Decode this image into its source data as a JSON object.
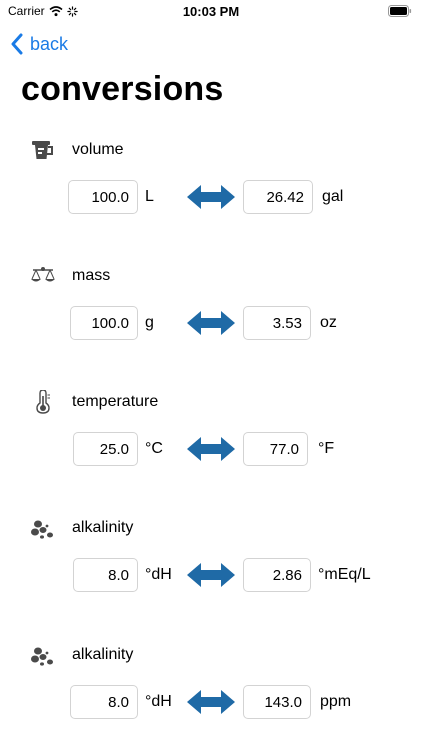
{
  "status_bar": {
    "carrier": "Carrier",
    "time": "10:03 PM"
  },
  "nav": {
    "back_label": "back"
  },
  "page": {
    "title": "conversions"
  },
  "colors": {
    "accent": "#1a7be6",
    "arrow": "#1f6aa6",
    "field_border": "#d3d3d3",
    "icon": "#4a4a4a"
  },
  "sections": [
    {
      "label": "volume",
      "icon": "measuring-cup-icon",
      "left_value": "100.0",
      "left_unit": "L",
      "right_value": "26.42",
      "right_unit": "gal"
    },
    {
      "label": "mass",
      "icon": "balance-scale-icon",
      "left_value": "100.0",
      "left_unit": "g",
      "right_value": "3.53",
      "right_unit": "oz"
    },
    {
      "label": "temperature",
      "icon": "thermometer-icon",
      "left_value": "25.0",
      "left_unit": "°C",
      "right_value": "77.0",
      "right_unit": "°F"
    },
    {
      "label": "alkalinity",
      "icon": "particles-icon",
      "left_value": "8.0",
      "left_unit": "°dH",
      "right_value": "2.86",
      "right_unit": "°mEq/L"
    },
    {
      "label": "alkalinity",
      "icon": "particles-icon",
      "left_value": "8.0",
      "left_unit": "°dH",
      "right_value": "143.0",
      "right_unit": "ppm"
    }
  ]
}
